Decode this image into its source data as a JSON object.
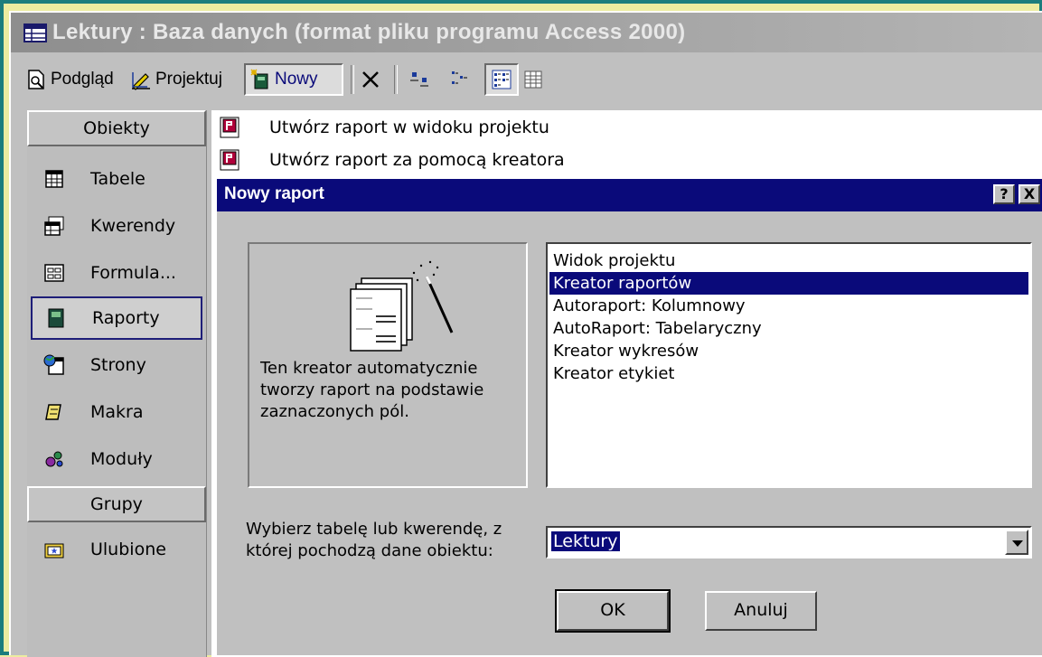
{
  "window": {
    "title": "Lektury : Baza danych (format pliku programu Access 2000)"
  },
  "toolbar": {
    "preview_label": "Podgląd",
    "design_label": "Projektuj",
    "new_label": "Nowy"
  },
  "sidebar": {
    "objects_header": "Obiekty",
    "items": [
      {
        "label": "Tabele",
        "icon": "table-icon"
      },
      {
        "label": "Kwerendy",
        "icon": "query-icon"
      },
      {
        "label": "Formula...",
        "icon": "form-icon"
      },
      {
        "label": "Raporty",
        "icon": "report-icon"
      },
      {
        "label": "Strony",
        "icon": "page-icon"
      },
      {
        "label": "Makra",
        "icon": "macro-icon"
      },
      {
        "label": "Moduły",
        "icon": "module-icon"
      }
    ],
    "groups_header": "Grupy",
    "groups": [
      {
        "label": "Ulubione",
        "icon": "favorites-icon"
      }
    ]
  },
  "main": {
    "rows": [
      {
        "label": "Utwórz raport w widoku projektu"
      },
      {
        "label": "Utwórz raport za pomocą kreatora"
      }
    ]
  },
  "dialog": {
    "title": "Nowy raport",
    "help_label": "?",
    "close_label": "X",
    "description": "Ten kreator automatycznie tworzy raport na podstawie zaznaczonych pól.",
    "options": [
      "Widok projektu",
      "Kreator raportów",
      "Autoraport:  Kolumnowy",
      "AutoRaport:  Tabelaryczny",
      "Kreator wykresów",
      "Kreator etykiet"
    ],
    "selected_option": "Kreator raportów",
    "source_label": "Wybierz tabelę lub kwerendę, z której pochodzą dane obiektu:",
    "source_value": "Lektury",
    "ok_label": "OK",
    "cancel_label": "Anuluj"
  }
}
